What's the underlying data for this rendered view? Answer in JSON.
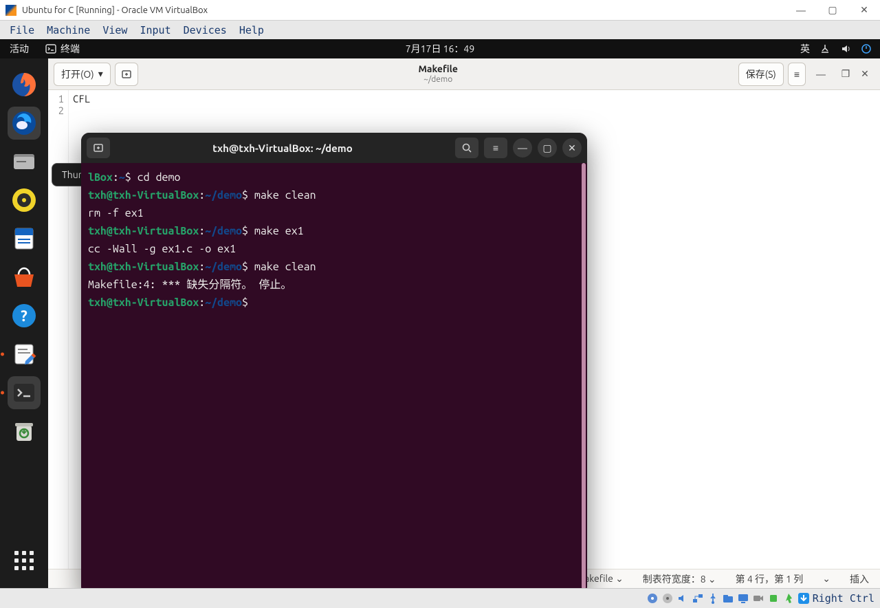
{
  "vbox": {
    "title": "Ubuntu for C [Running] - Oracle VM VirtualBox",
    "menu": [
      "File",
      "Machine",
      "View",
      "Input",
      "Devices",
      "Help"
    ],
    "hostkey": "Right Ctrl"
  },
  "gnome": {
    "activities": "活动",
    "app_indicator": "终端",
    "clock": "7月17日  16：49",
    "ime": "英"
  },
  "tooltip": "Thunderbird 邮件/新闻",
  "gedit": {
    "open_label": "打开(O)",
    "save_label": "保存(S)",
    "title": "Makefile",
    "subtitle": "~/demo",
    "lines": [
      "CFL",
      ""
    ],
    "gutter": [
      "1",
      "2"
    ],
    "status": {
      "lang": "Makefile",
      "tab": "制表符宽度：8",
      "pos": "第 4 行，第 1 列",
      "mode": "插入"
    }
  },
  "terminal": {
    "title": "txh@txh-VirtualBox: ~/demo",
    "lines": [
      {
        "user": "",
        "host": "lBox",
        "sep": ":",
        "path": "~",
        "prompt": "$",
        "cmd": " cd demo"
      },
      {
        "user": "txh@txh-VirtualBox",
        "sep": ":",
        "path": "~/demo",
        "prompt": "$",
        "cmd": " make clean"
      },
      {
        "plain": "rm -f ex1"
      },
      {
        "user": "txh@txh-VirtualBox",
        "sep": ":",
        "path": "~/demo",
        "prompt": "$",
        "cmd": " make ex1"
      },
      {
        "plain": "cc -Wall -g    ex1.c   -o ex1"
      },
      {
        "user": "txh@txh-VirtualBox",
        "sep": ":",
        "path": "~/demo",
        "prompt": "$",
        "cmd": " make clean"
      },
      {
        "plain": "Makefile:4: *** 缺失分隔符。 停止。"
      },
      {
        "user": "txh@txh-VirtualBox",
        "sep": ":",
        "path": "~/demo",
        "prompt": "$",
        "cmd": " "
      }
    ]
  }
}
